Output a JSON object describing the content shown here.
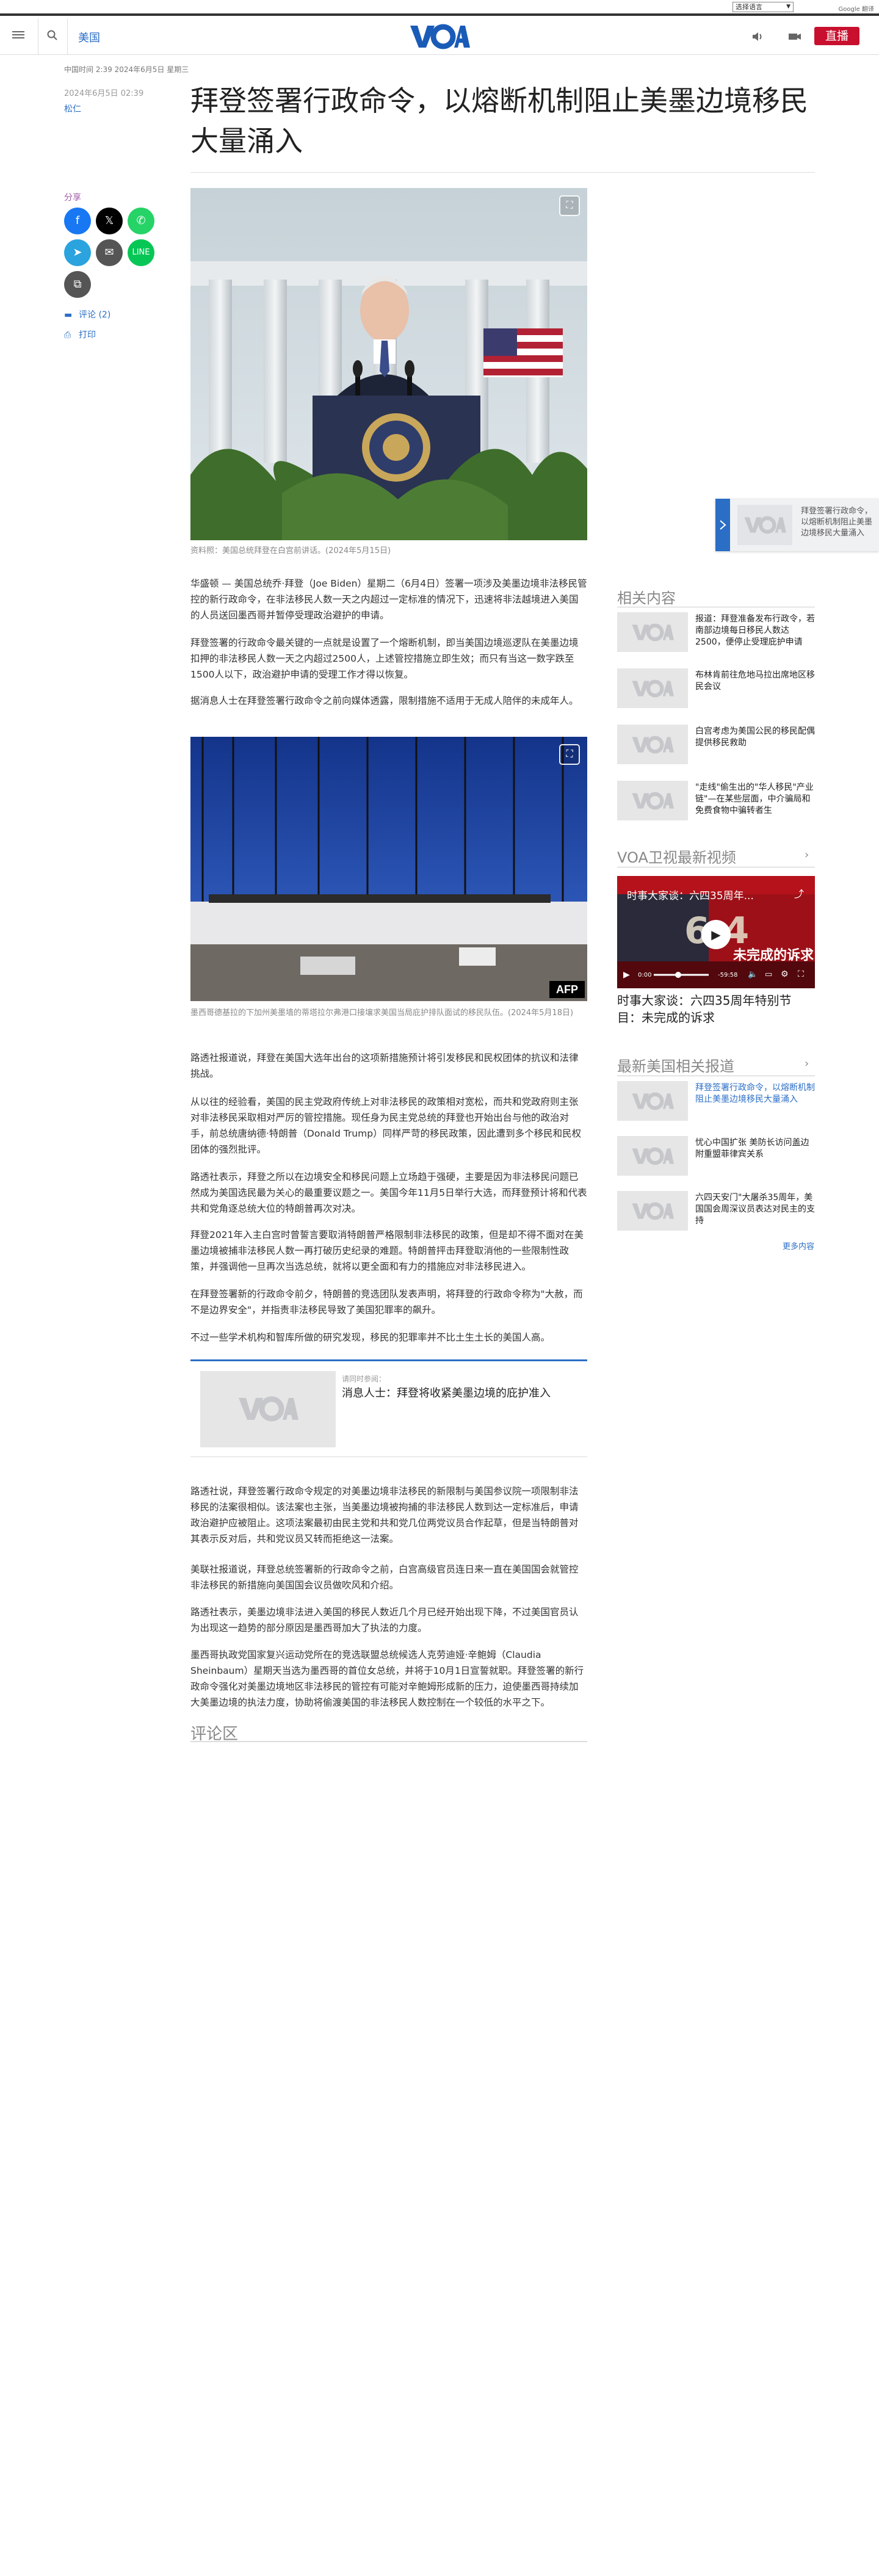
{
  "topbar": {
    "language_select": "选择语言",
    "translate_credit": "Google 翻译"
  },
  "header": {
    "section": "美国",
    "live_label": "直播"
  },
  "article": {
    "time_meta": "中国时间 2:39 2024年6月5日 星期三",
    "date": "2024年6月5日 02:39",
    "author": "松仁",
    "title": "拜登签署行政命令，以熔断机制阻止美墨边境移民大量涌入",
    "hero_caption": "资料照：美国总统拜登在白宫前讲话。(2024年5月15日)",
    "paragraphs": [
      "华盛顿 — 美国总统乔·拜登（Joe Biden）星期二（6月4日）签署一项涉及美墨边境非法移民管控的新行政命令，在非法移民人数一天之内超过一定标准的情况下，迅速将非法越境进入美国的人员送回墨西哥并暂停受理政治避护的申请。",
      "拜登签署的行政命令最关键的一点就是设置了一个熔断机制，即当美国边境巡逻队在美墨边境扣押的非法移民人数一天之内超过2500人，上述管控措施立即生效；而只有当这一数字跌至1500人以下，政治避护申请的受理工作才得以恢复。",
      "据消息人士在拜登签署行政命令之前向媒体透露，限制措施不适用于无成人陪伴的未成年人。"
    ],
    "img2_caption": "墨西哥德基拉的下加州美墨墙的蒂塔拉尔弗港口接壤求美国当局庇护排队面试的移民队伍。(2024年5月18日)",
    "paragraphs2": [
      "路透社报道说，拜登在美国大选年出台的这项新措施预计将引发移民和民权团体的抗议和法律挑战。",
      "从以往的经验看，美国的民主党政府传统上对非法移民的政策相对宽松，而共和党政府则主张对非法移民采取相对严厉的管控措施。现任身为民主党总统的拜登也开始出台与他的政治对手，前总统唐纳德·特朗普（Donald Trump）同样严苛的移民政策，因此遭到多个移民和民权团体的强烈批评。",
      "路透社表示，拜登之所以在边境安全和移民问题上立场趋于强硬，主要是因为非法移民问题已然成为美国选民最为关心的最重要议题之一。美国今年11月5日举行大选，而拜登预计将和代表共和党角逐总统大位的特朗普再次对决。",
      "拜登2021年入主白宫时曾誓言要取消特朗普严格限制非法移民的政策，但是却不得不面对在美墨边境被捕非法移民人数一再打破历史纪录的难题。特朗普抨击拜登取消他的一些限制性政策，并强调他一旦再次当选总统，就将以更全面和有力的措施应对非法移民进入。",
      "在拜登签署新的行政命令前夕，特朗普的竞选团队发表声明，将拜登的行政命令称为\"大赦，而不是边界安全\"，并指责非法移民导致了美国犯罪率的飙升。",
      "不过一些学术机构和智库所做的研究发现，移民的犯罪率并不比土生土长的美国人高。"
    ],
    "embed": {
      "label": "请同时参阅：",
      "title": "消息人士：拜登将收紧美墨边境的庇护准入"
    },
    "paragraphs3": [
      "路透社说，拜登签署行政命令规定的对美墨边境非法移民的新限制与美国参议院一项限制非法移民的法案很相似。该法案也主张，当美墨边境被拘捕的非法移民人数到达一定标准后，申请政治避护应被阻止。这项法案最初由民主党和共和党几位两党议员合作起草，但是当特朗普对其表示反对后，共和党议员又转而拒绝这一法案。",
      "美联社报道说，拜登总统签署新的行政命令之前，白宫高级官员连日来一直在美国国会就管控非法移民的新措施向美国国会议员做吹风和介绍。",
      "路透社表示，美墨边境非法进入美国的移民人数近几个月已经开始出现下降，不过美国官员认为出现这一趋势的部分原因是墨西哥加大了执法的力度。",
      "墨西哥执政党国家复兴运动党所在的竞选联盟总统候选人克劳迪娅·辛鲍姆（Claudia Sheinbaum）星期天当选为墨西哥的首位女总统，并将于10月1日宣誓就职。拜登签署的新行政命令强化对美墨边境地区非法移民的管控有可能对辛鲍姆形成新的压力，迫使墨西哥持续加大美墨边境的执法力度，协助将偷渡美国的非法移民人数控制在一个较低的水平之下。"
    ],
    "comments_title": "评论区"
  },
  "share": {
    "label": "分享",
    "comments_link": "评论 (2)",
    "print_link": "打印"
  },
  "sidebar": {
    "related_title": "相关内容",
    "related": [
      "报道：拜登准备发布行政令，若南部边境每日移民人数达2500，便停止受理庇护申请",
      "布林肯前往危地马拉出席地区移民会议",
      "白宫考虑为美国公民的移民配偶提供移民救助",
      "\"走线\"偷生出的\"华人移民\"产业链\"—在某些层面，中介骗局和免费食物中骗转者生"
    ],
    "video_section_title": "VOA卫视最新视频",
    "video": {
      "overlay_title": "时事大家谈：六四35周年...",
      "banner_text": "未完成的诉求",
      "time_current": "0:00",
      "time_total": "-59:58",
      "caption": "时事大家谈：六四35周年特别节目：未完成的诉求"
    },
    "latest_title": "最新美国相关报道",
    "latest": [
      "拜登签署行政命令，以熔断机制阻止美墨边境移民大量涌入",
      "忧心中国扩张 美防长访问盖边附重盟菲律宾关系",
      "六四天安门\"大屠杀35周年，美国国会周深议员表达对民主的支持"
    ],
    "more_label": "更多内容"
  },
  "sticky": {
    "text": "拜登签署行政命令，以熔断机制阻止美墨边境移民大量涌入"
  },
  "colors": {
    "accent": "#2b6ec5",
    "live": "#c8102e",
    "share_label": "#a158a8"
  }
}
